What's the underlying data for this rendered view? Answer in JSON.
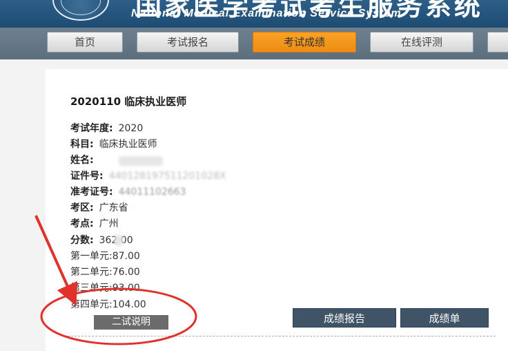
{
  "header": {
    "title_cn": "国家医学考试考生服务系统",
    "title_en": "National Medical Examination Service System"
  },
  "nav": {
    "tabs": [
      {
        "label": "首页"
      },
      {
        "label": "考试报名"
      },
      {
        "label": "考试成绩",
        "active": true
      },
      {
        "label": "在线评测"
      }
    ]
  },
  "result": {
    "heading": "2020110  临床执业医师",
    "fields": {
      "year_label": "考试年度:",
      "year_value": "2020",
      "subject_label": "科目:",
      "subject_value": "临床执业医师",
      "name_label": "姓名:",
      "id_label": "证件号:",
      "id_value": "440128197511201028X",
      "admit_label": "准考证号:",
      "admit_value": "44011102663",
      "area_label": "考区:",
      "area_value": "广东省",
      "site_label": "考点:",
      "site_value": "广州",
      "score_label": "分数:",
      "score_value": "362.00",
      "unit1_label": "第一单元:",
      "unit1_value": "87.00",
      "unit2_label": "第二单元:",
      "unit2_value": "76.00",
      "unit3_label": "第三单元:",
      "unit3_value": "93.00",
      "unit4_label": "第四单元:",
      "unit4_value": "104.00"
    },
    "explain_label": "二试说明",
    "report_label": "成绩报告",
    "transcript_label": "成绩单"
  },
  "colors": {
    "header": "#2c5f88",
    "active_tab": "#f39a1e",
    "dark_button": "#3f5466",
    "annotation_red": "#e0312a"
  }
}
